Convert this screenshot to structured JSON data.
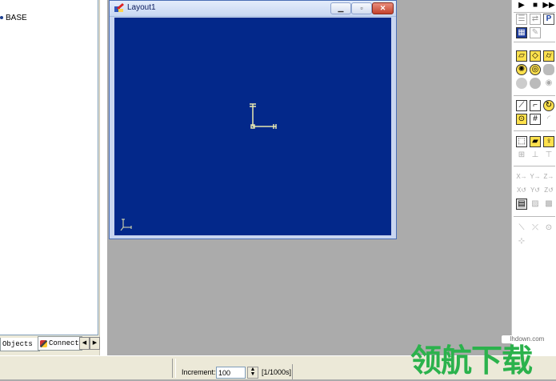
{
  "object_tree": {
    "root_node": "BASE"
  },
  "panel_tabs": [
    {
      "label": "Objects"
    },
    {
      "label": "Connect"
    }
  ],
  "layout_window": {
    "title": "Layout1",
    "minimize_icon": "minimize-icon",
    "maximize_icon": "maximize-icon",
    "close_icon": "close-icon",
    "viewport_background": "#03288a",
    "axis_color": "#e8e8b0"
  },
  "statusbar": {
    "increment_label": "Increment:",
    "increment_value": "100",
    "increment_units": "[1/1000s]"
  },
  "watermark": {
    "url": "lhdown.com",
    "text": "领航下载"
  },
  "toolbar": {
    "play_icon": "play-icon",
    "stop_icon": "stop-icon",
    "fast_forward_icon": "fast-forward-icon"
  }
}
